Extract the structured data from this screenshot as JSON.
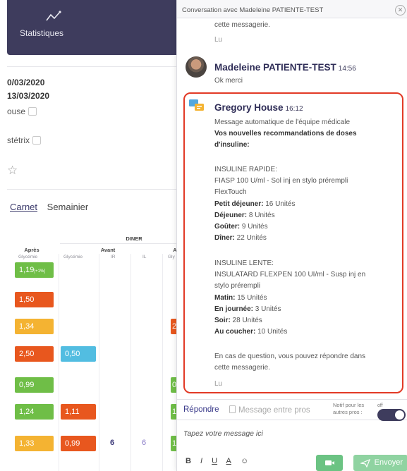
{
  "left": {
    "stats_label": "Statistiques",
    "date1": "0/03/2020",
    "date2": "13/03/2020",
    "field1": "ouse",
    "field2": "stétrix",
    "tabs": {
      "carnet": "Carnet",
      "semainier": "Semainier"
    },
    "table": {
      "group": "DINER",
      "col_apres": "Après",
      "col_avant": "Avant",
      "col_a": "A",
      "sub_glycemie": "Glycémie",
      "sub_ir": "IR",
      "sub_il": "IL",
      "sub_gly_short": "Gly",
      "apres_values": [
        "1,19",
        "1,50",
        "1,34",
        "2,50",
        "0,99",
        "1,24",
        "1,33"
      ],
      "apres_extra": "[+1%]",
      "glycemie_values": [
        "0,50",
        "1,11",
        "0,99"
      ],
      "third_values": [
        "2",
        "0",
        "1",
        "1"
      ],
      "ir_value": "6",
      "il_value": "6",
      "colors": {
        "green": "#6fbe47",
        "orange": "#e8571e",
        "yellow": "#f4b332",
        "blue": "#52bde1"
      }
    }
  },
  "conv": {
    "title": "Conversation avec Madeleine PATIENTE-TEST",
    "prev_tail": "cette messagerie.",
    "lu": "Lu",
    "msg1": {
      "sender": "Madeleine PATIENTE-TEST",
      "time": "14:56",
      "text": "Ok merci"
    },
    "msg2": {
      "sender": "Gregory House",
      "time": "16:12",
      "lines": [
        "Message automatique de l'équipe médicale",
        "Vos nouvelles recommandations de doses",
        "d'insuline:",
        "INSULINE RAPIDE:",
        "FIASP 100 U/ml - Sol inj en stylo prérempli",
        "FlexTouch",
        "Petit déjeuner:",
        " 16 Unités",
        "Déjeuner:",
        " 8 Unités",
        "Goûter:",
        " 9 Unités",
        "Dîner:",
        " 22 Unités",
        "INSULINE LENTE:",
        "INSULATARD FLEXPEN 100 UI/ml - Susp inj en",
        "stylo prérempli",
        "Matin:",
        " 15 Unités",
        "En journée:",
        " 3 Unités",
        "Soir:",
        " 28 Unités",
        "Au coucher:",
        " 10 Unités",
        "En cas de question, vous pouvez répondre dans",
        "cette messagerie."
      ]
    },
    "compose": {
      "tab_reply": "Répondre",
      "tab_pros": "Message entre pros",
      "notif": "Notif pour les autres pros :",
      "off": "off",
      "placeholder": "Tapez votre message ici",
      "fmt": [
        "B",
        "I",
        "U",
        "A",
        "☺"
      ],
      "send": "Envoyer"
    },
    "accent": "#3e3c5d",
    "highlight_color": "#e23a26"
  }
}
